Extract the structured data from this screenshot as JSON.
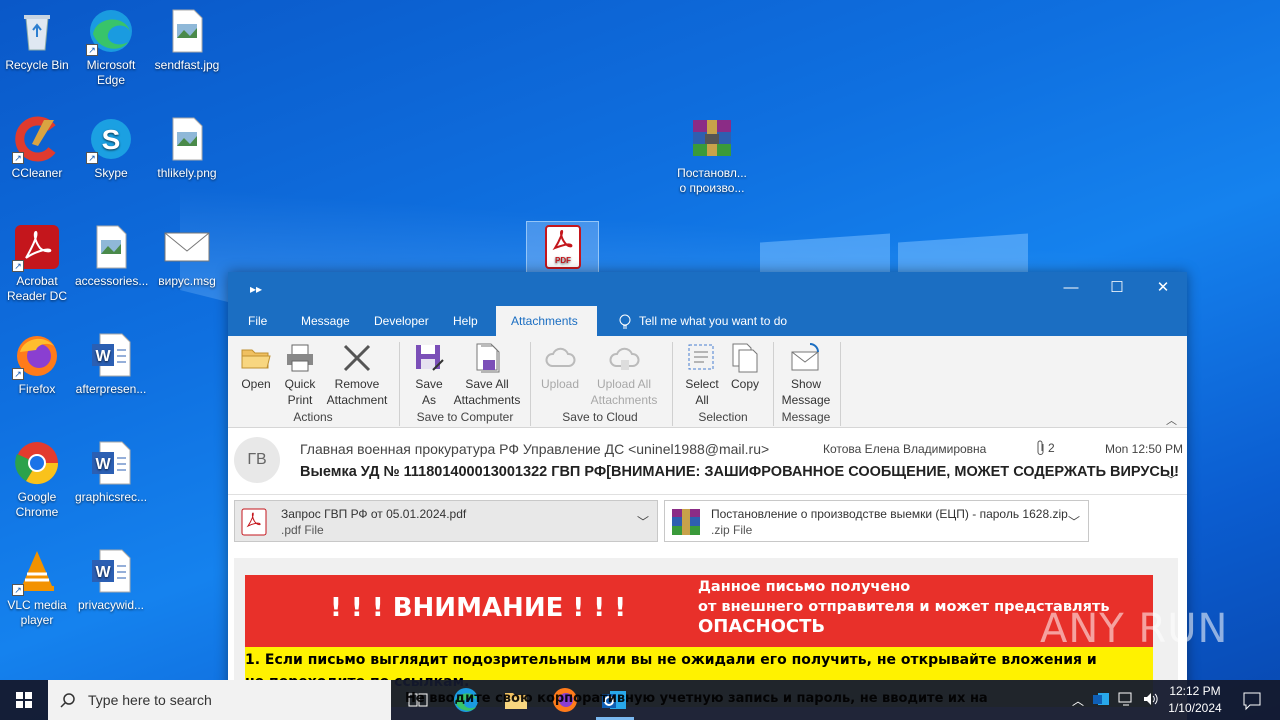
{
  "desktop": {
    "icons": [
      {
        "label": "Recycle Bin",
        "icon": "recycle-bin-icon"
      },
      {
        "label": "Microsoft Edge",
        "icon": "edge-icon"
      },
      {
        "label": "sendfast.jpg",
        "icon": "image-file-icon"
      },
      {
        "label": "CCleaner",
        "icon": "ccleaner-icon"
      },
      {
        "label": "Skype",
        "icon": "skype-icon"
      },
      {
        "label": "thlikely.png",
        "icon": "image-file-icon"
      },
      {
        "label": "Acrobat Reader DC",
        "icon": "acrobat-icon"
      },
      {
        "label": "accessories...",
        "icon": "image-file-icon"
      },
      {
        "label": "вирус.msg",
        "icon": "mail-icon"
      },
      {
        "label": "Firefox",
        "icon": "firefox-icon"
      },
      {
        "label": "afterpresen...",
        "icon": "word-icon"
      },
      {
        "label": "Google Chrome",
        "icon": "chrome-icon"
      },
      {
        "label": "graphicsrec...",
        "icon": "word-icon"
      },
      {
        "label": "VLC media player",
        "icon": "vlc-icon"
      },
      {
        "label": "privacywid...",
        "icon": "word-icon"
      },
      {
        "label": "Постановл... о произво...",
        "icon": "winrar-icon"
      }
    ]
  },
  "window": {
    "quick_access": "▸▸",
    "controls": {
      "minimize": "—",
      "maximize": "☐",
      "close": "✕"
    },
    "tabs": [
      "File",
      "Message",
      "Developer",
      "Help",
      "Attachments"
    ],
    "tell_me": "Tell me what you want to do",
    "ribbon": {
      "buttons": {
        "open": "Open",
        "quick_print": "Quick Print",
        "remove": "Remove Attachment",
        "save_as": "Save As",
        "save_all": "Save All Attachments",
        "upload": "Upload",
        "upload_all": "Upload All Attachments",
        "select_all": "Select All",
        "copy": "Copy",
        "show_message": "Show Message"
      },
      "groups": [
        "Actions",
        "Save to Computer",
        "Save to Cloud",
        "Selection",
        "Message"
      ]
    },
    "message": {
      "avatar": "ГВ",
      "from": "Главная военная прокуратура РФ Управление ДС <uninel1988@mail.ru>",
      "to": "Котова Елена Владимировна",
      "attachment_count": "2",
      "time": "Mon 12:50 PM",
      "subject": "Выемка УД № 111801400013001322  ГВП РФ[ВНИМАНИЕ: ЗАШИФРОВАННОЕ СООБЩЕНИЕ, МОЖЕТ СОДЕРЖАТЬ ВИРУСЫ!"
    },
    "attachments": [
      {
        "name": "Запрос ГВП РФ от 05.01.2024.pdf",
        "type": ".pdf File"
      },
      {
        "name": "Постановление о производстве выемки (ЕЦП) - пароль 1628.zip",
        "type": ".zip File"
      }
    ],
    "body": {
      "warning": "! ! ! ВНИМАНИЕ ! ! !",
      "note_line1": "Данное письмо получено",
      "note_line2": "от внешнего отправителя и может представлять",
      "note_line3": "ОПАСНОСТЬ",
      "yellow_line1": "1. Если письмо выглядит подозрительным или вы не ожидали его получить, не открывайте вложения и",
      "yellow_line2": "не переходите по ссылкам."
    }
  },
  "taskbar": {
    "search_placeholder": "Type here to search",
    "overlay_text": "Не вводите свою корпоративную учетную запись и пароль, не вводите их на",
    "clock_time": "12:12 PM",
    "clock_date": "1/10/2024"
  },
  "watermark": "ANY RUN"
}
